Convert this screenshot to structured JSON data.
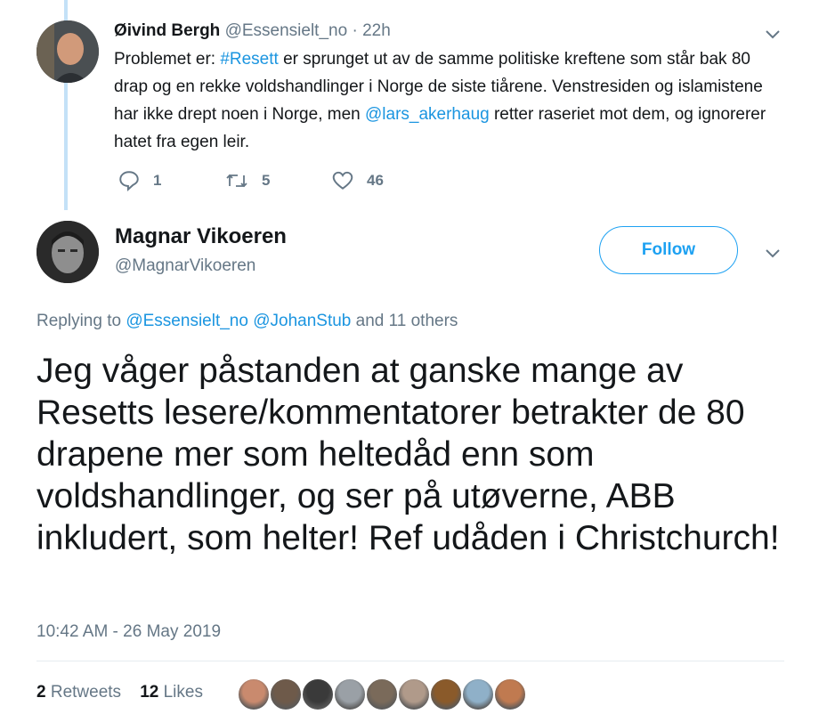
{
  "parent_tweet": {
    "author_name": "Øivind Bergh",
    "author_handle": "@Essensielt_no",
    "separator": "·",
    "time_ago": "22h",
    "text_1": "Problemet er: ",
    "hashtag": "#Resett",
    "text_2": " er sprunget ut av de samme politiske kreftene som står bak 80 drap og en rekke voldshandlinger i Norge de siste tiårene. Venstresiden og islamistene har ikke drept noen i Norge, men ",
    "mention": "@lars_akerhaug",
    "text_3": " retter raseriet mot dem, og ignorerer hatet fra egen leir.",
    "replies": "1",
    "retweets": "5",
    "likes": "46"
  },
  "main_tweet": {
    "author_name": "Magnar Vikoeren",
    "author_handle": "@MagnarVikoeren",
    "follow_label": "Follow",
    "replying_prefix": "Replying to ",
    "replying_to_1": "@Essensielt_no",
    "replying_to_2": "@JohanStub",
    "replying_suffix": " and 11 others",
    "text": "Jeg våger påstanden at ganske mange av Resetts lesere/kommentatorer betrakter de 80 drapene mer som heltedåd enn som voldshandlinger, og ser på utøverne, ABB inkludert, som helter! Ref udåden i Christchurch!",
    "timestamp": "10:42 AM - 26 May 2019",
    "retweet_count": "2",
    "retweet_label": "Retweets",
    "like_count": "12",
    "like_label": "Likes"
  },
  "liker_avatar_colors": [
    "#c98a6e",
    "#6e5a4a",
    "#3a3a3a",
    "#9aa0a6",
    "#7a6a5a",
    "#b09a8a",
    "#8a5a2a",
    "#8fb0c8",
    "#c07a50"
  ],
  "colors": {
    "link": "#1b95e0",
    "accent": "#1da1f2",
    "muted": "#657786",
    "thread_line": "#c4e1f7"
  },
  "icons": [
    "reply-icon",
    "retweet-icon",
    "heart-icon",
    "chevron-down-icon"
  ]
}
